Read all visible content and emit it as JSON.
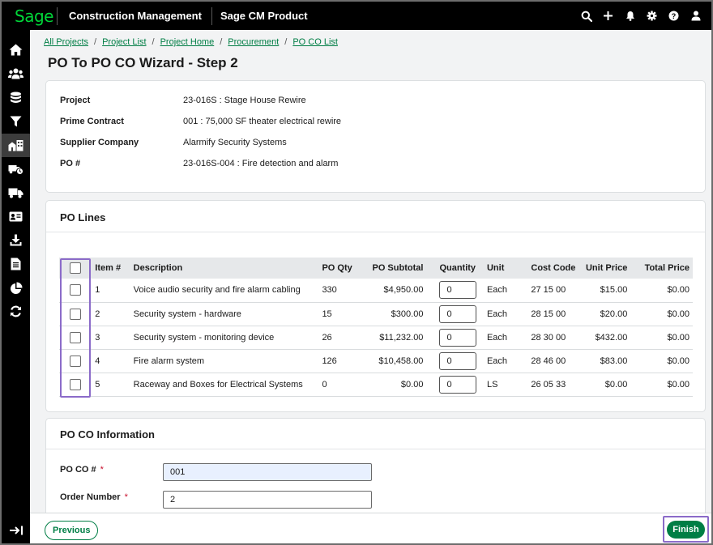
{
  "topbar": {
    "logo": "Sage",
    "app_title": "Construction Management",
    "product_title": "Sage CM Product",
    "actions": [
      "search-icon",
      "add-icon",
      "bell-icon",
      "gear-icon",
      "help-icon",
      "user-icon"
    ]
  },
  "sidebar": {
    "items": [
      "home-icon",
      "people-icon",
      "database-icon",
      "filter-icon",
      "building-icon",
      "truck-clock-icon",
      "truck-icon",
      "id-card-icon",
      "download-icon",
      "document-icon",
      "pie-chart-icon",
      "refresh-icon"
    ],
    "active_index": 4,
    "collapse_icon": "collapse-icon"
  },
  "breadcrumb": [
    "All Projects",
    "Project List",
    "Project Home",
    "Procurement",
    "PO CO List"
  ],
  "page_title": "PO To PO CO Wizard - Step 2",
  "summary": {
    "project_label": "Project",
    "project_value": "23-016S : Stage House Rewire",
    "prime_contract_label": "Prime Contract",
    "prime_contract_value": "001 : 75,000 SF theater electrical rewire",
    "supplier_label": "Supplier Company",
    "supplier_value": "Alarmify Security Systems",
    "po_label": "PO #",
    "po_value": "23-016S-004 : Fire detection and alarm"
  },
  "po_lines": {
    "title": "PO Lines",
    "columns": [
      "Item #",
      "Description",
      "PO Qty",
      "PO Subtotal",
      "Quantity",
      "Unit",
      "Cost Code",
      "Unit Price",
      "Total Price"
    ],
    "rows": [
      {
        "item": "1",
        "description": "Voice audio security and fire alarm cabling",
        "po_qty": "330",
        "po_subtotal": "$4,950.00",
        "quantity": "0",
        "unit": "Each",
        "cost_code": "27 15 00",
        "unit_price": "$15.00",
        "total_price": "$0.00"
      },
      {
        "item": "2",
        "description": "Security system - hardware",
        "po_qty": "15",
        "po_subtotal": "$300.00",
        "quantity": "0",
        "unit": "Each",
        "cost_code": "28 15 00",
        "unit_price": "$20.00",
        "total_price": "$0.00"
      },
      {
        "item": "3",
        "description": "Security system - monitoring device",
        "po_qty": "26",
        "po_subtotal": "$11,232.00",
        "quantity": "0",
        "unit": "Each",
        "cost_code": "28 30 00",
        "unit_price": "$432.00",
        "total_price": "$0.00"
      },
      {
        "item": "4",
        "description": "Fire alarm system",
        "po_qty": "126",
        "po_subtotal": "$10,458.00",
        "quantity": "0",
        "unit": "Each",
        "cost_code": "28 46 00",
        "unit_price": "$83.00",
        "total_price": "$0.00"
      },
      {
        "item": "5",
        "description": "Raceway and Boxes for Electrical Systems",
        "po_qty": "0",
        "po_subtotal": "$0.00",
        "quantity": "0",
        "unit": "LS",
        "cost_code": "26 05 33",
        "unit_price": "$0.00",
        "total_price": "$0.00"
      }
    ]
  },
  "po_co_info": {
    "title": "PO CO Information",
    "po_co_label": "PO CO #",
    "po_co_value": "001",
    "order_number_label": "Order Number",
    "order_number_value": "2",
    "required_marker": "*"
  },
  "footer": {
    "previous_label": "Previous",
    "finish_label": "Finish"
  },
  "colors": {
    "brand_green": "#007e45",
    "logo_green": "#00d639",
    "highlight_purple": "#8b6bc9"
  }
}
